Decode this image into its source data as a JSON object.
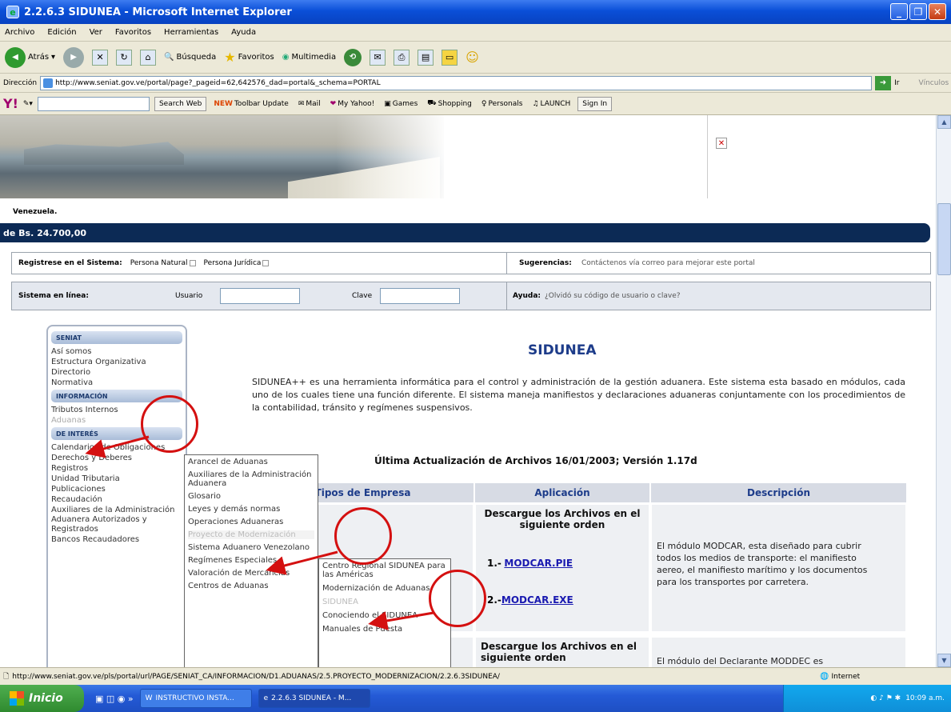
{
  "window": {
    "title": "2.2.6.3 SIDUNEA - Microsoft Internet Explorer"
  },
  "menu": [
    "Archivo",
    "Edición",
    "Ver",
    "Favoritos",
    "Herramientas",
    "Ayuda"
  ],
  "toolbar": {
    "back": "Atrás",
    "search": "Búsqueda",
    "favorites": "Favoritos",
    "multimedia": "Multimedia"
  },
  "address": {
    "label": "Dirección",
    "url": "http://www.seniat.gov.ve/portal/page?_pageid=62,642576_dad=portal&_schema=PORTAL",
    "go": "Ir",
    "links": "Vínculos"
  },
  "yahoo": {
    "search_web": "Search Web",
    "toolbar_update": "Toolbar Update",
    "mail": "Mail",
    "my_yahoo": "My Yahoo!",
    "games": "Games",
    "shopping": "Shopping",
    "personals": "Personals",
    "launch": "LAUNCH",
    "sign_in": "Sign In"
  },
  "page": {
    "venezuela": "Venezuela.",
    "ut_bar": "de Bs. 24.700,00",
    "register": {
      "label": "Registrese en el Sistema:",
      "natural": "Persona Natural",
      "juridica": "Persona Jurídica",
      "suggest_label": "Sugerencias:",
      "suggest_text": "Contáctenos vía correo para mejorar este portal"
    },
    "online": {
      "label": "Sistema en línea:",
      "user": "Usuario",
      "password": "Clave",
      "help_label": "Ayuda:",
      "help_text": "¿Olvidó su código de usuario o clave?"
    },
    "nav": {
      "seniat_head": "SENIAT",
      "seniat_items": [
        "Así somos",
        "Estructura Organizativa",
        "Directorio",
        "Normativa"
      ],
      "info_head": "INFORMACIÓN",
      "info_items": [
        "Tributos Internos",
        "Aduanas"
      ],
      "interest_head": "DE INTERÉS",
      "interest_items": [
        "Calendarios de Obligaciones",
        "Derechos y Deberes",
        "Registros",
        "Unidad Tributaria",
        "Publicaciones",
        "Recaudación",
        "Auxiliares de la Administración Aduanera Autorizados y Registrados",
        "Bancos Recaudadores"
      ]
    },
    "submenu1": [
      "Arancel de Aduanas",
      "Auxiliares de la Administración Aduanera",
      "Glosario",
      "Leyes y demás normas",
      "Operaciones Aduaneras",
      "Proyecto de Modernización",
      "Sistema Aduanero Venezolano",
      "Regímenes Especiales",
      "Valoración de Mercancías",
      "Centros de Aduanas"
    ],
    "submenu2": [
      "Centro Regional SIDUNEA para las Américas",
      "Modernización de Aduanas",
      "SIDUNEA",
      "Conociendo el SIDUNEA",
      "Manuales de Puesta"
    ],
    "title": "SIDUNEA",
    "intro": "SIDUNEA++ es una herramienta informática para el control y administración de la gestión aduanera. Este sistema esta basado en módulos, cada uno de los cuales tiene una función diferente. El sistema maneja manifiestos y declaraciones aduaneras conjuntamente con los procedimientos de la contabilidad, tránsito y regímenes suspensivos.",
    "update": "Última Actualización de Archivos 16/01/2003; Versión 1.17d",
    "table": {
      "headers": [
        "Tipos de Empresa",
        "Aplicación",
        "Descripción"
      ],
      "download": "Descargue los Archivos en el siguiente orden",
      "link1": "MODCAR.PIE",
      "link2": "MODCAR.EXE",
      "prefix1": "1.-",
      "prefix2": "2.-",
      "desc1": "El módulo MODCAR, esta diseñado para cubrir todos los medios de transporte: el manifiesto aereo, el manifiesto marítimo y los documentos para los transportes por carretera.",
      "download2": "Descargue los Archivos en el siguiente orden",
      "desc2": "El módulo del Declarante MODDEC es"
    }
  },
  "status": {
    "url": "http://www.seniat.gov.ve/pls/portal/url/PAGE/SENIAT_CA/INFORMACION/D1.ADUANAS/2.5.PROYECTO_MODERNIZACION/2.2.6.3SIDUNEA/",
    "zone": "Internet"
  },
  "taskbar": {
    "start": "Inicio",
    "task1": "INSTRUCTIVO INSTA...",
    "task2": "2.2.6.3 SIDUNEA - M...",
    "clock": "10:09 a.m."
  }
}
